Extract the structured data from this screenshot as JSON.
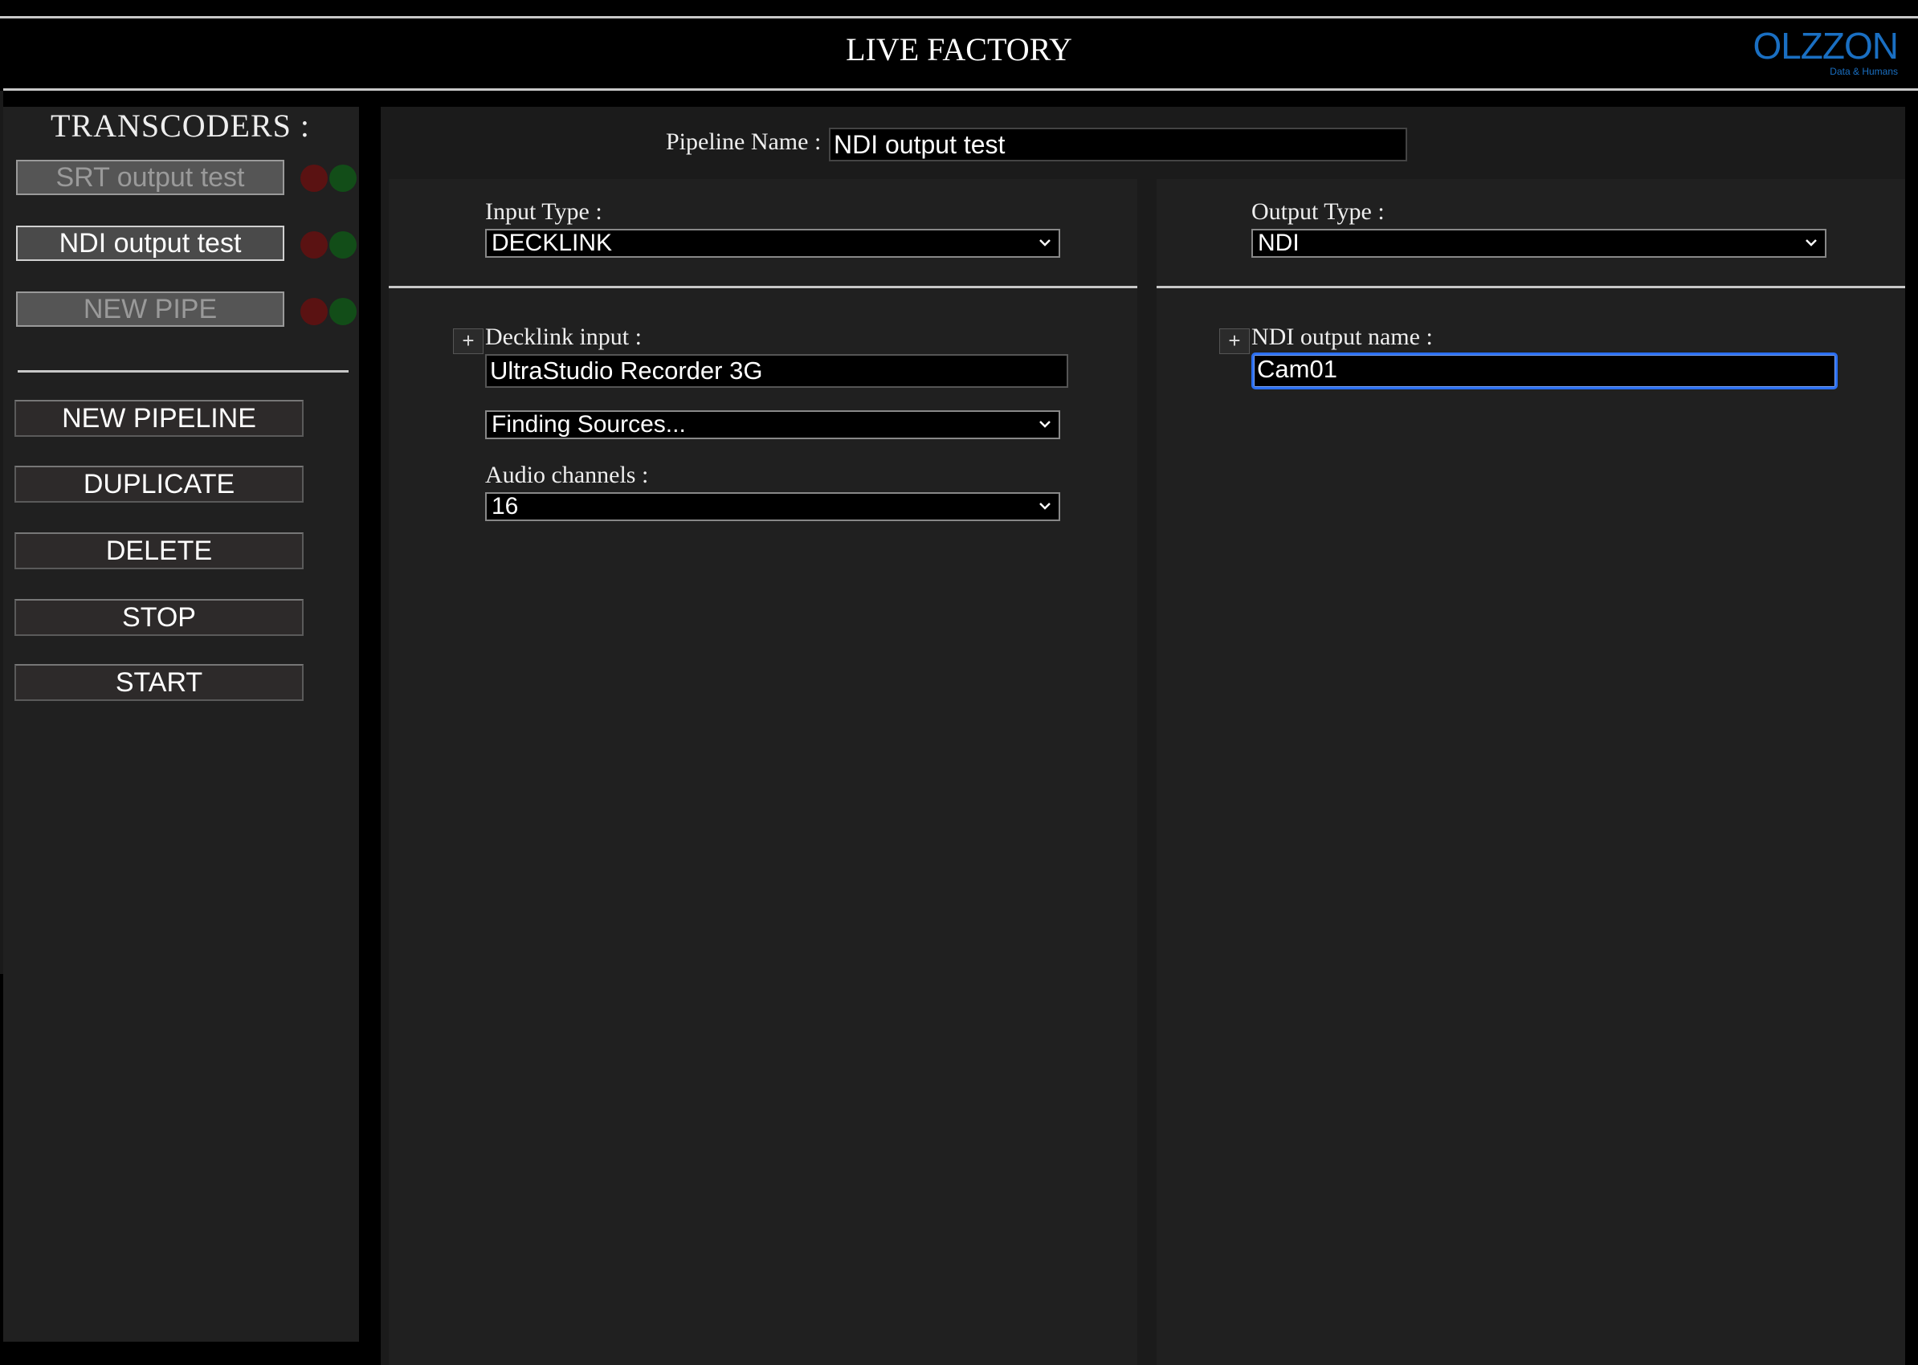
{
  "header": {
    "title": "LIVE FACTORY",
    "logo_text": "OLZZON",
    "logo_tagline": "Data & Humans",
    "logo_color": "#1a6fc2"
  },
  "sidebar": {
    "title": "TRANSCODERS :",
    "pipelines": [
      {
        "label": "SRT output test",
        "active": false
      },
      {
        "label": "NDI output test",
        "active": true
      },
      {
        "label": "NEW PIPE",
        "active": false
      }
    ],
    "actions": {
      "new_pipeline": "NEW PIPELINE",
      "duplicate": "DUPLICATE",
      "delete": "DELETE",
      "stop": "STOP",
      "start": "START"
    }
  },
  "main": {
    "pipeline_name_label": "Pipeline Name :",
    "pipeline_name_value": "NDI output test",
    "input": {
      "type_label": "Input Type :",
      "type_value": "DECKLINK",
      "plus_label": "+",
      "decklink_label": "Decklink input :",
      "decklink_value": "UltraStudio Recorder 3G",
      "sources_value": "Finding Sources...",
      "audio_label": "Audio channels :",
      "audio_value": "16"
    },
    "output": {
      "type_label": "Output Type :",
      "type_value": "NDI",
      "plus_label": "+",
      "ndi_name_label": "NDI output name :",
      "ndi_name_value": "Cam01"
    }
  }
}
